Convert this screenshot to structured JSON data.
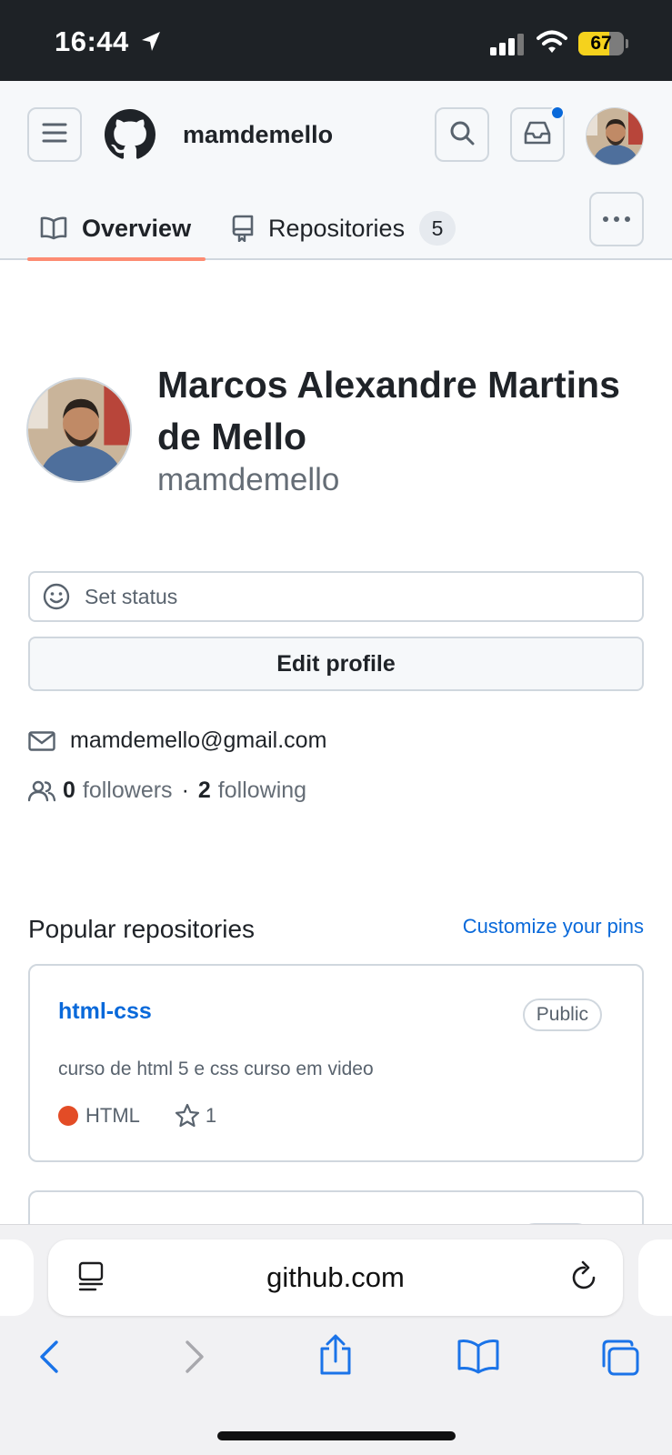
{
  "status_bar": {
    "time": "16:44",
    "battery": "67",
    "battery_level": 0.67
  },
  "header": {
    "username": "mamdemello",
    "has_unread_notifications": true
  },
  "tabs": [
    {
      "label": "Overview",
      "selected": true
    },
    {
      "label": "Repositories",
      "count": "5",
      "selected": false
    }
  ],
  "profile": {
    "full_name": "Marcos Alexandre Martins de Mello",
    "login": "mamdemello",
    "set_status": "Set status",
    "edit_profile": "Edit profile",
    "email": "mamdemello@gmail.com",
    "followers_count": "0",
    "followers_label": "followers",
    "separator": "·",
    "following_count": "2",
    "following_label": "following"
  },
  "popular": {
    "title": "Popular repositories",
    "customize": "Customize your pins",
    "repos": [
      {
        "name": "html-css",
        "visibility": "Public",
        "description": "curso de html 5 e css curso em video",
        "language": "HTML",
        "language_color": "#e34c26",
        "stars": "1"
      }
    ]
  },
  "browser": {
    "url": "github.com"
  },
  "colors": {
    "link": "#0969da",
    "tab_underline": "#fd8c73",
    "notification": "#0969da"
  }
}
